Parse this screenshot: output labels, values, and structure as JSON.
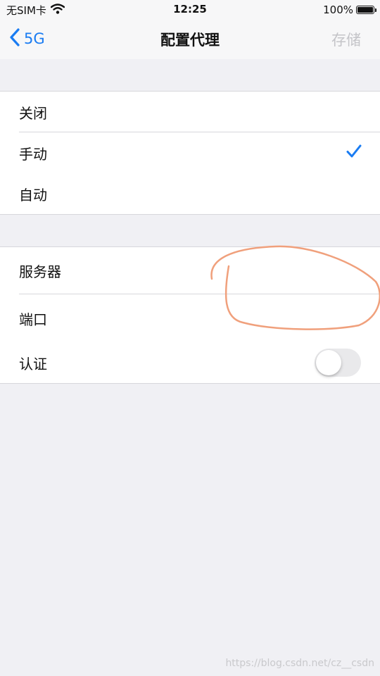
{
  "status_bar": {
    "carrier": "无SIM卡",
    "time": "12:25",
    "battery_percent": "100%",
    "battery_level": 1.0
  },
  "nav": {
    "back_label": "5G",
    "title": "配置代理",
    "save_label": "存储"
  },
  "proxy_modes": {
    "items": [
      {
        "label": "关闭",
        "selected": false
      },
      {
        "label": "手动",
        "selected": true
      },
      {
        "label": "自动",
        "selected": false
      }
    ]
  },
  "manual_settings": {
    "server_label": "服务器",
    "server_value": "",
    "port_label": "端口",
    "port_value": "",
    "auth_label": "认证",
    "auth_enabled": false
  },
  "watermark": "https://blog.csdn.net/cz__csdn",
  "colors": {
    "accent": "#1a7cf2",
    "disabled_text": "#c4c4c8",
    "annotation_stroke": "#f0a07c",
    "background": "#f0f0f4"
  }
}
